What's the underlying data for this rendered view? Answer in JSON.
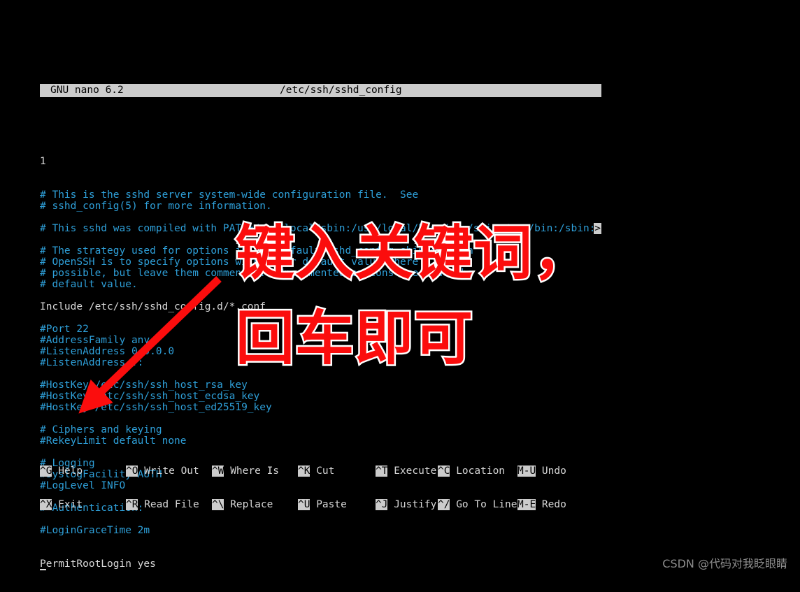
{
  "titlebar": {
    "version": "GNU nano 6.2",
    "filename": "/etc/ssh/sshd_config"
  },
  "editor": {
    "first_marker": "1",
    "continuation_marker": ">",
    "cursor_char": "P",
    "cursor_line_rest": "ermitRootLogin yes",
    "lines": [
      {
        "text": "# This is the sshd server system-wide configuration file.  See",
        "style": "comment"
      },
      {
        "text": "# sshd_config(5) for more information.",
        "style": "comment"
      },
      {
        "text": "",
        "style": "blank"
      },
      {
        "text": "# This sshd was compiled with PATH=/usr/local/sbin:/usr/local/bin:/usr/sbin:/usr/bin:/sbin:/bin:/us",
        "style": "comment-overflow"
      },
      {
        "text": "",
        "style": "blank"
      },
      {
        "text": "# The strategy used for options in the default sshd_config shipped with",
        "style": "comment"
      },
      {
        "text": "# OpenSSH is to specify options with their default value where",
        "style": "comment"
      },
      {
        "text": "# possible, but leave them commented.  Uncommented options override the",
        "style": "comment"
      },
      {
        "text": "# default value.",
        "style": "comment"
      },
      {
        "text": "",
        "style": "blank"
      },
      {
        "text": "Include /etc/ssh/sshd_config.d/*.conf",
        "style": "plain"
      },
      {
        "text": "",
        "style": "blank"
      },
      {
        "text": "#Port 22",
        "style": "comment"
      },
      {
        "text": "#AddressFamily any",
        "style": "comment"
      },
      {
        "text": "#ListenAddress 0.0.0.0",
        "style": "comment"
      },
      {
        "text": "#ListenAddress ::",
        "style": "comment"
      },
      {
        "text": "",
        "style": "blank"
      },
      {
        "text": "#HostKey /etc/ssh/ssh_host_rsa_key",
        "style": "comment"
      },
      {
        "text": "#HostKey /etc/ssh/ssh_host_ecdsa_key",
        "style": "comment"
      },
      {
        "text": "#HostKey /etc/ssh/ssh_host_ed25519_key",
        "style": "comment"
      },
      {
        "text": "",
        "style": "blank"
      },
      {
        "text": "# Ciphers and keying",
        "style": "comment"
      },
      {
        "text": "#RekeyLimit default none",
        "style": "comment"
      },
      {
        "text": "",
        "style": "blank"
      },
      {
        "text": "# Logging",
        "style": "comment"
      },
      {
        "text": "#SyslogFacility AUTH",
        "style": "comment"
      },
      {
        "text": "#LogLevel INFO",
        "style": "comment"
      },
      {
        "text": "",
        "style": "blank"
      },
      {
        "text": "# Authentication:",
        "style": "comment"
      },
      {
        "text": "",
        "style": "blank"
      },
      {
        "text": "#LoginGraceTime 2m",
        "style": "comment"
      }
    ]
  },
  "shortcuts": {
    "row1": [
      {
        "key": "^G",
        "label": "Help"
      },
      {
        "key": "^O",
        "label": "Write Out"
      },
      {
        "key": "^W",
        "label": "Where Is"
      },
      {
        "key": "^K",
        "label": "Cut"
      },
      {
        "key": "^T",
        "label": "Execute"
      },
      {
        "key": "^C",
        "label": "Location"
      },
      {
        "key": "M-U",
        "label": "Undo"
      }
    ],
    "row2": [
      {
        "key": "^X",
        "label": "Exit"
      },
      {
        "key": "^R",
        "label": "Read File"
      },
      {
        "key": "^\\",
        "label": "Replace"
      },
      {
        "key": "^U",
        "label": "Paste"
      },
      {
        "key": "^J",
        "label": "Justify"
      },
      {
        "key": "^/",
        "label": "Go To Line"
      },
      {
        "key": "M-E",
        "label": "Redo"
      }
    ]
  },
  "annotation": {
    "line1": "键入关键词，",
    "line2": "回车即可",
    "color": "#fb0d0d",
    "outline_color": "#ffffff",
    "arrow_color": "#fb0d0d"
  },
  "watermark": {
    "text": "CSDN @代码对我眨眼睛"
  }
}
